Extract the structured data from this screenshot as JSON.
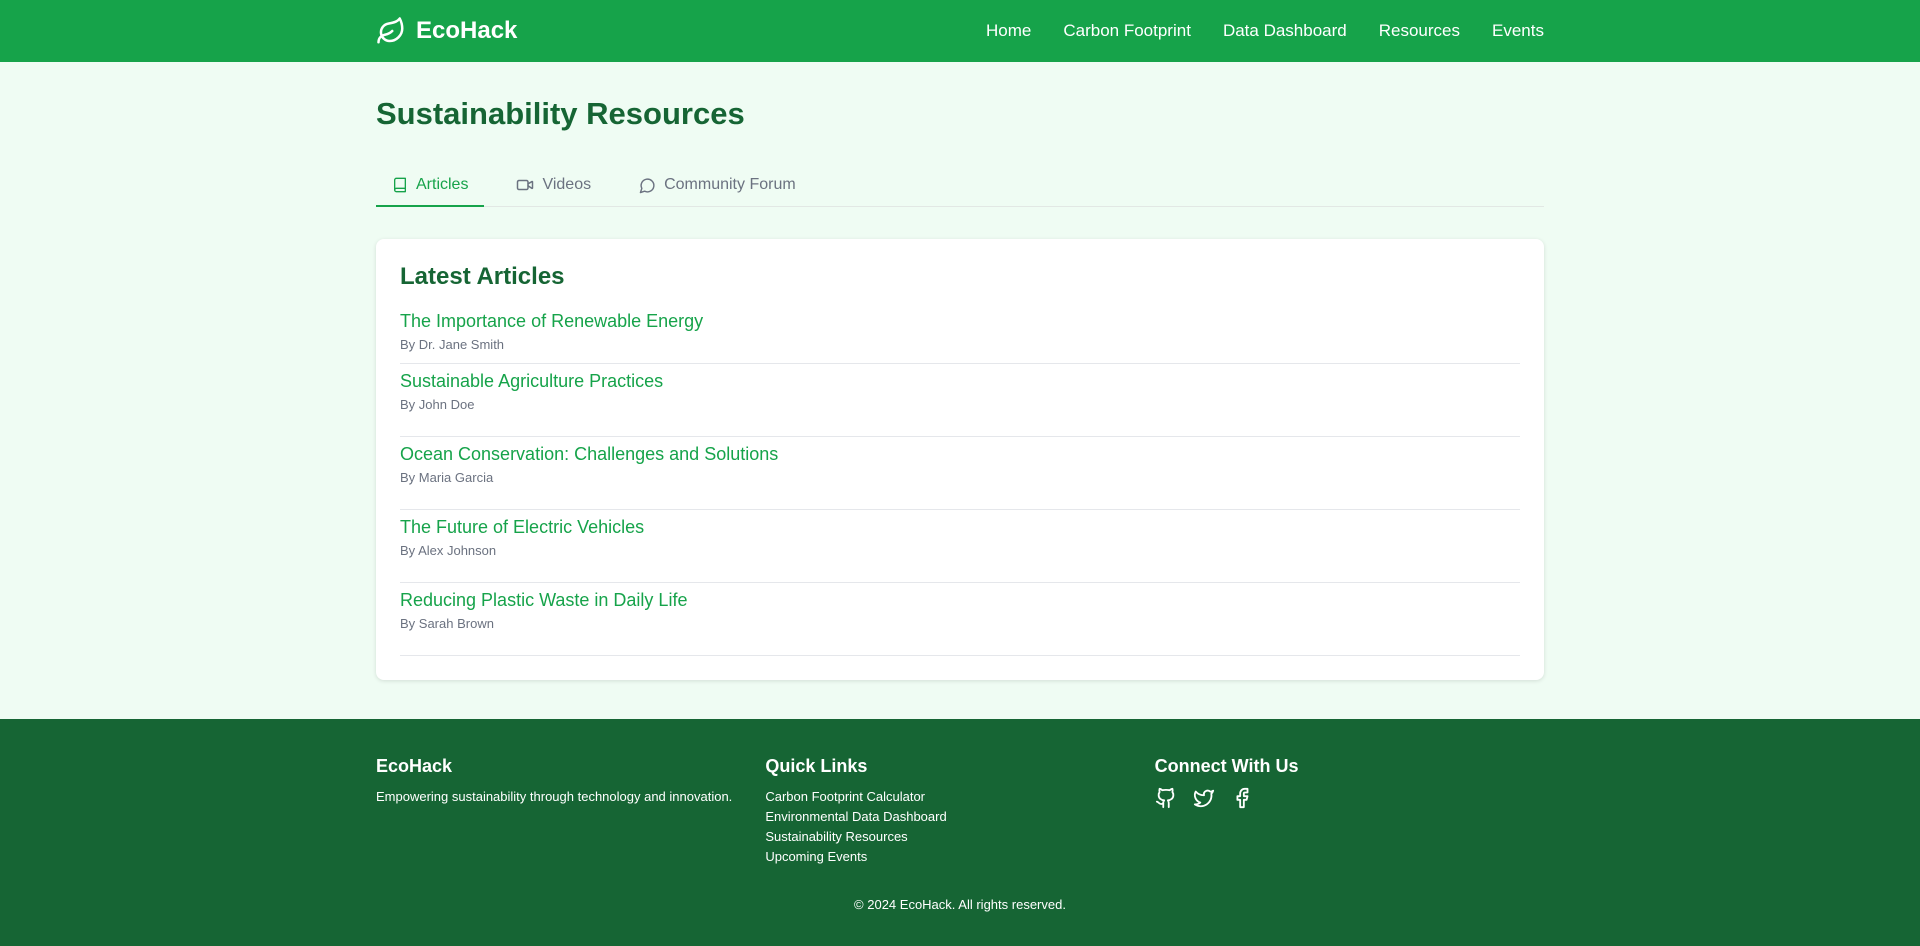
{
  "header": {
    "brand": "EcoHack",
    "nav": [
      "Home",
      "Carbon Footprint",
      "Data Dashboard",
      "Resources",
      "Events"
    ]
  },
  "page": {
    "title": "Sustainability Resources",
    "tabs": [
      {
        "label": "Articles",
        "icon": "book-icon",
        "active": true
      },
      {
        "label": "Videos",
        "icon": "video-icon",
        "active": false
      },
      {
        "label": "Community Forum",
        "icon": "chat-bubble-icon",
        "active": false
      }
    ]
  },
  "articles": {
    "heading": "Latest Articles",
    "items": [
      {
        "title": "The Importance of Renewable Energy",
        "author": "By Dr. Jane Smith"
      },
      {
        "title": "Sustainable Agriculture Practices",
        "author": "By John Doe"
      },
      {
        "title": "Ocean Conservation: Challenges and Solutions",
        "author": "By Maria Garcia"
      },
      {
        "title": "The Future of Electric Vehicles",
        "author": "By Alex Johnson"
      },
      {
        "title": "Reducing Plastic Waste in Daily Life",
        "author": "By Sarah Brown"
      }
    ]
  },
  "footer": {
    "brand": "EcoHack",
    "tagline": "Empowering sustainability through technology and innovation.",
    "quick_links_heading": "Quick Links",
    "quick_links": [
      "Carbon Footprint Calculator",
      "Environmental Data Dashboard",
      "Sustainability Resources",
      "Upcoming Events"
    ],
    "connect_heading": "Connect With Us",
    "social_icons": [
      "github-icon",
      "twitter-icon",
      "facebook-icon"
    ],
    "copyright": "© 2024 EcoHack. All rights reserved."
  },
  "colors": {
    "primary": "#16a34a",
    "dark": "#166534",
    "background": "#effcf3"
  }
}
